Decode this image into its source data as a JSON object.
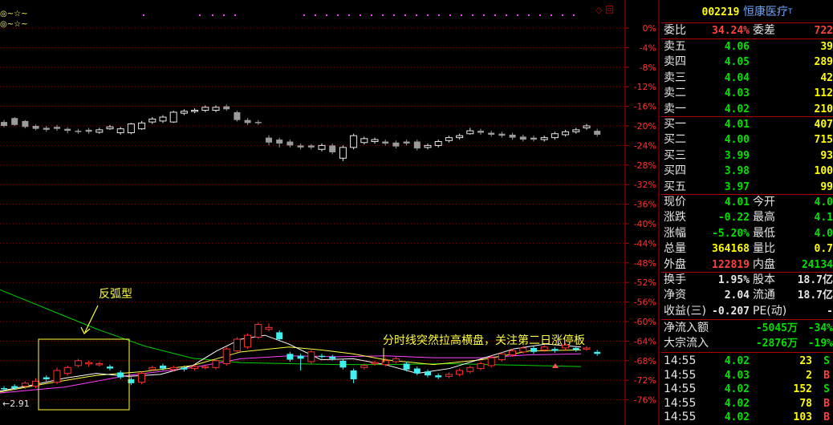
{
  "legend": {
    "line1": "◎~☆~",
    "line2": "◎~☆~"
  },
  "window_icons": {
    "diamond": "◇",
    "box": "回"
  },
  "axis": {
    "pct_labels": [
      "0%",
      "-4%",
      "-8%",
      "-12%",
      "-16%",
      "-20%",
      "-24%",
      "-28%",
      "-32%",
      "-36%",
      "-40%",
      "-44%",
      "-48%",
      "-52%",
      "-56%",
      "-60%",
      "-64%",
      "-68%",
      "-72%",
      "-76%"
    ]
  },
  "annotations": {
    "arc_label": "反弧型",
    "note": "分时线突然拉高横盘，关注第二日涨停板",
    "low_marker": "←2.91"
  },
  "stock": {
    "code": "002219",
    "name": "恒康医疗",
    "mark": "T"
  },
  "commission": {
    "label": "委比",
    "ratio": "34.24%",
    "diff_label": "委差",
    "diff": "722"
  },
  "sell_orders": [
    {
      "label": "卖五",
      "price": "4.06",
      "vol": "39"
    },
    {
      "label": "卖四",
      "price": "4.05",
      "vol": "289"
    },
    {
      "label": "卖三",
      "price": "4.04",
      "vol": "42"
    },
    {
      "label": "卖二",
      "price": "4.03",
      "vol": "112"
    },
    {
      "label": "卖一",
      "price": "4.02",
      "vol": "210"
    }
  ],
  "buy_orders": [
    {
      "label": "买一",
      "price": "4.01",
      "vol": "407"
    },
    {
      "label": "买二",
      "price": "4.00",
      "vol": "715"
    },
    {
      "label": "买三",
      "price": "3.99",
      "vol": "93"
    },
    {
      "label": "买四",
      "price": "3.98",
      "vol": "100"
    },
    {
      "label": "买五",
      "price": "3.97",
      "vol": "99"
    }
  ],
  "quote": [
    {
      "l1": "现价",
      "v1": "4.01",
      "c1": "green",
      "l2": "今开",
      "v2": "4.0",
      "c2": "green"
    },
    {
      "l1": "涨跌",
      "v1": "-0.22",
      "c1": "green",
      "l2": "最高",
      "v2": "4.1",
      "c2": "green"
    },
    {
      "l1": "涨幅",
      "v1": "-5.20%",
      "c1": "green",
      "l2": "最低",
      "v2": "4.0",
      "c2": "green"
    },
    {
      "l1": "总量",
      "v1": "364168",
      "c1": "yellow",
      "l2": "量比",
      "v2": "0.7",
      "c2": "yellow"
    },
    {
      "l1": "外盘",
      "v1": "122819",
      "c1": "red",
      "l2": "内盘",
      "v2": "24134",
      "c2": "green"
    }
  ],
  "finance": [
    {
      "l1": "换手",
      "v1": "1.95%",
      "l2": "股本",
      "v2": "18.7亿"
    },
    {
      "l1": "净资",
      "v1": "2.04",
      "l2": "流通",
      "v2": "18.7亿"
    },
    {
      "l1": "收益(三)",
      "v1": "-0.207",
      "l2": "PE(动)",
      "v2": "-"
    }
  ],
  "flows": [
    {
      "label": "净流入额",
      "v1": "-5045万",
      "v2": "-34%"
    },
    {
      "label": "大宗流入",
      "v1": "-2876万",
      "v2": "-19%"
    }
  ],
  "ticks": [
    {
      "time": "14:55",
      "price": "4.02",
      "vol": "23",
      "side": "S"
    },
    {
      "time": "14:55",
      "price": "4.03",
      "vol": "2",
      "side": "B"
    },
    {
      "time": "14:55",
      "price": "4.02",
      "vol": "152",
      "side": "S"
    },
    {
      "time": "14:55",
      "price": "4.02",
      "vol": "78",
      "side": "B"
    },
    {
      "time": "14:55",
      "price": "4.02",
      "vol": "103",
      "side": "B"
    }
  ],
  "chart_data": {
    "type": "candlestick",
    "y_axis_unit": "%",
    "ylim": [
      -78,
      2
    ],
    "upper_series_pct": [
      {
        "o": -19.2,
        "c": -20.0,
        "h": -18.8,
        "l": -20.3
      },
      {
        "o": -18.4,
        "c": -19.8,
        "h": -18.2,
        "l": -20.0
      },
      {
        "o": -19.0,
        "c": -20.2,
        "h": -18.8,
        "l": -20.5
      },
      {
        "o": -20.0,
        "c": -20.6,
        "h": -19.7,
        "l": -20.9
      },
      {
        "o": -20.4,
        "c": -20.8,
        "h": -20.0,
        "l": -21.2
      },
      {
        "o": -20.2,
        "c": -20.6,
        "h": -19.8,
        "l": -21.0
      },
      {
        "o": -20.6,
        "c": -21.0,
        "h": -20.3,
        "l": -21.5
      },
      {
        "o": -21.0,
        "c": -21.2,
        "h": -20.6,
        "l": -21.6
      },
      {
        "o": -20.8,
        "c": -21.2,
        "h": -20.4,
        "l": -21.6
      },
      {
        "o": -21.3,
        "c": -20.8,
        "h": -20.4,
        "l": -21.6
      },
      {
        "o": -20.6,
        "c": -20.2,
        "h": -19.8,
        "l": -20.8
      },
      {
        "o": -21.4,
        "c": -20.6,
        "h": -20.2,
        "l": -21.8
      },
      {
        "o": -21.4,
        "c": -19.6,
        "h": -19.4,
        "l": -21.7
      },
      {
        "o": -20.6,
        "c": -19.4,
        "h": -19.0,
        "l": -20.8
      },
      {
        "o": -19.2,
        "c": -18.6,
        "h": -18.2,
        "l": -19.6
      },
      {
        "o": -19.0,
        "c": -18.2,
        "h": -17.8,
        "l": -19.4
      },
      {
        "o": -19.2,
        "c": -17.2,
        "h": -16.9,
        "l": -19.4
      },
      {
        "o": -17.4,
        "c": -17.0,
        "h": -16.6,
        "l": -17.8
      },
      {
        "o": -17.0,
        "c": -16.8,
        "h": -16.4,
        "l": -17.4
      },
      {
        "o": -16.8,
        "c": -16.2,
        "h": -15.8,
        "l": -17.2
      },
      {
        "o": -16.8,
        "c": -16.2,
        "h": -15.8,
        "l": -17.2
      },
      {
        "o": -16.0,
        "c": -16.6,
        "h": -15.6,
        "l": -16.9
      },
      {
        "o": -17.2,
        "c": -18.8,
        "h": -16.9,
        "l": -19.1
      },
      {
        "o": -18.8,
        "c": -19.4,
        "h": -18.4,
        "l": -19.8
      },
      {
        "o": -19.2,
        "c": -19.4,
        "h": -18.8,
        "l": -19.8
      },
      {
        "o": -22.4,
        "c": -23.4,
        "h": -21.9,
        "l": -24.0
      },
      {
        "o": -22.8,
        "c": -23.6,
        "h": -22.4,
        "l": -24.4
      },
      {
        "o": -23.2,
        "c": -24.0,
        "h": -22.8,
        "l": -24.4
      },
      {
        "o": -24.0,
        "c": -24.4,
        "h": -23.6,
        "l": -24.8
      },
      {
        "o": -24.0,
        "c": -24.4,
        "h": -23.7,
        "l": -24.8
      },
      {
        "o": -24.8,
        "c": -24.0,
        "h": -23.6,
        "l": -25.2
      },
      {
        "o": -24.0,
        "c": -25.4,
        "h": -23.6,
        "l": -25.8
      },
      {
        "o": -26.6,
        "c": -24.4,
        "h": -24.0,
        "l": -27.2
      },
      {
        "o": -24.4,
        "c": -22.0,
        "h": -21.6,
        "l": -24.8
      },
      {
        "o": -23.4,
        "c": -22.6,
        "h": -22.2,
        "l": -23.8
      },
      {
        "o": -23.2,
        "c": -22.8,
        "h": -22.4,
        "l": -23.6
      },
      {
        "o": -23.2,
        "c": -23.6,
        "h": -22.8,
        "l": -24.0
      },
      {
        "o": -23.4,
        "c": -24.2,
        "h": -23.0,
        "l": -24.6
      },
      {
        "o": -23.2,
        "c": -23.6,
        "h": -22.8,
        "l": -24.0
      },
      {
        "o": -23.2,
        "c": -24.6,
        "h": -22.8,
        "l": -25.0
      },
      {
        "o": -24.4,
        "c": -24.0,
        "h": -23.6,
        "l": -24.8
      },
      {
        "o": -24.0,
        "c": -23.2,
        "h": -22.8,
        "l": -24.4
      },
      {
        "o": -23.0,
        "c": -22.4,
        "h": -22.0,
        "l": -23.4
      },
      {
        "o": -22.4,
        "c": -22.0,
        "h": -21.6,
        "l": -22.8
      },
      {
        "o": -21.6,
        "c": -21.0,
        "h": -20.4,
        "l": -21.8
      },
      {
        "o": -21.0,
        "c": -21.4,
        "h": -20.6,
        "l": -21.8
      },
      {
        "o": -21.4,
        "c": -21.8,
        "h": -21.0,
        "l": -22.2
      },
      {
        "o": -21.6,
        "c": -22.0,
        "h": -21.2,
        "l": -22.4
      },
      {
        "o": -21.8,
        "c": -22.4,
        "h": -21.4,
        "l": -22.8
      },
      {
        "o": -22.2,
        "c": -22.8,
        "h": -21.8,
        "l": -23.2
      },
      {
        "o": -22.4,
        "c": -22.8,
        "h": -22.0,
        "l": -23.2
      },
      {
        "o": -22.8,
        "c": -22.4,
        "h": -22.0,
        "l": -23.2
      },
      {
        "o": -22.4,
        "c": -21.6,
        "h": -21.2,
        "l": -22.8
      },
      {
        "o": -21.8,
        "c": -21.2,
        "h": -20.8,
        "l": -22.2
      },
      {
        "o": -21.2,
        "c": -20.8,
        "h": -20.4,
        "l": -21.6
      },
      {
        "o": -20.4,
        "c": -20.0,
        "h": -19.6,
        "l": -20.8
      },
      {
        "o": -21.0,
        "c": -21.8,
        "h": -20.6,
        "l": -22.2
      }
    ],
    "lower_series_pct": [
      {
        "o": -73.6,
        "c": -73.8,
        "h": -73.2,
        "l": -74.2
      },
      {
        "o": -73.2,
        "c": -73.6,
        "h": -72.8,
        "l": -74.0
      },
      {
        "o": -73.2,
        "c": -72.6,
        "h": -72.2,
        "l": -73.8
      },
      {
        "o": -73.2,
        "c": -72.2,
        "h": -71.6,
        "l": -73.6
      },
      {
        "o": -71.4,
        "c": -71.8,
        "h": -71.0,
        "l": -72.2
      },
      {
        "o": -72.4,
        "c": -70.0,
        "h": -69.4,
        "l": -72.8
      },
      {
        "o": -70.6,
        "c": -69.4,
        "h": -69.0,
        "l": -71.0
      },
      {
        "o": -69.0,
        "c": -68.0,
        "h": -67.6,
        "l": -69.4
      },
      {
        "o": -68.6,
        "c": -68.4,
        "h": -68.0,
        "l": -69.2
      },
      {
        "o": -68.8,
        "c": -68.6,
        "h": -68.2,
        "l": -69.2
      },
      {
        "o": -69.2,
        "c": -69.6,
        "h": -68.8,
        "l": -70.0
      },
      {
        "o": -70.4,
        "c": -71.4,
        "h": -70.0,
        "l": -71.8
      },
      {
        "o": -71.8,
        "c": -72.6,
        "h": -71.4,
        "l": -73.0
      },
      {
        "o": -72.4,
        "c": -70.6,
        "h": -70.2,
        "l": -72.8
      },
      {
        "o": -69.8,
        "c": -69.4,
        "h": -69.0,
        "l": -70.2
      },
      {
        "o": -69.0,
        "c": -69.6,
        "h": -68.6,
        "l": -70.0
      },
      {
        "o": -69.8,
        "c": -69.4,
        "h": -69.0,
        "l": -70.2
      },
      {
        "o": -69.4,
        "c": -69.8,
        "h": -69.0,
        "l": -70.2
      },
      {
        "o": -69.6,
        "c": -69.2,
        "h": -68.8,
        "l": -70.0
      },
      {
        "o": -69.4,
        "c": -69.2,
        "h": -68.8,
        "l": -69.8
      },
      {
        "o": -69.4,
        "c": -68.0,
        "h": -67.6,
        "l": -69.8
      },
      {
        "o": -68.6,
        "c": -65.6,
        "h": -65.2,
        "l": -69.0
      },
      {
        "o": -66.0,
        "c": -63.6,
        "h": -63.2,
        "l": -66.4
      },
      {
        "o": -65.2,
        "c": -62.8,
        "h": -62.4,
        "l": -65.6
      },
      {
        "o": -63.2,
        "c": -60.6,
        "h": -60.2,
        "l": -63.6
      },
      {
        "o": -61.6,
        "c": -61.2,
        "h": -60.4,
        "l": -62.0
      },
      {
        "o": -62.2,
        "c": -63.6,
        "h": -61.8,
        "l": -64.0
      },
      {
        "o": -66.6,
        "c": -67.8,
        "h": -66.2,
        "l": -68.2
      },
      {
        "o": -67.0,
        "c": -67.6,
        "h": -66.6,
        "l": -70.0
      },
      {
        "o": -68.2,
        "c": -66.2,
        "h": -65.8,
        "l": -68.6
      },
      {
        "o": -67.0,
        "c": -67.2,
        "h": -66.6,
        "l": -67.6
      },
      {
        "o": -67.2,
        "c": -67.6,
        "h": -66.8,
        "l": -68.0
      },
      {
        "o": -68.0,
        "c": -69.4,
        "h": -67.6,
        "l": -69.8
      },
      {
        "o": -70.0,
        "c": -71.8,
        "h": -69.6,
        "l": -72.6
      },
      {
        "o": -69.4,
        "c": -69.0,
        "h": -68.6,
        "l": -69.8
      },
      {
        "o": -68.6,
        "c": -68.4,
        "h": -68.0,
        "l": -69.0
      },
      {
        "o": -68.8,
        "c": -68.0,
        "h": -67.4,
        "l": -69.2
      },
      {
        "o": -68.2,
        "c": -67.6,
        "h": -67.2,
        "l": -68.6
      },
      {
        "o": -68.6,
        "c": -69.8,
        "h": -68.2,
        "l": -70.2
      },
      {
        "o": -69.6,
        "c": -70.6,
        "h": -69.2,
        "l": -71.0
      },
      {
        "o": -70.2,
        "c": -71.0,
        "h": -69.8,
        "l": -71.4
      },
      {
        "o": -71.0,
        "c": -71.4,
        "h": -70.6,
        "l": -71.8
      },
      {
        "o": -71.2,
        "c": -70.8,
        "h": -70.4,
        "l": -71.6
      },
      {
        "o": -70.8,
        "c": -70.0,
        "h": -69.6,
        "l": -71.2
      },
      {
        "o": -70.2,
        "c": -69.4,
        "h": -69.0,
        "l": -70.6
      },
      {
        "o": -69.6,
        "c": -68.6,
        "h": -68.2,
        "l": -70.0
      },
      {
        "o": -69.0,
        "c": -67.4,
        "h": -67.0,
        "l": -69.4
      },
      {
        "o": -67.8,
        "c": -66.6,
        "h": -66.2,
        "l": -68.2
      },
      {
        "o": -66.8,
        "c": -66.0,
        "h": -65.6,
        "l": -67.2
      },
      {
        "o": -66.2,
        "c": -65.4,
        "h": -65.0,
        "l": -66.6
      },
      {
        "o": -65.4,
        "c": -66.2,
        "h": -65.0,
        "l": -66.6
      },
      {
        "o": -65.8,
        "c": -65.2,
        "h": -64.8,
        "l": -66.2
      },
      {
        "o": -65.6,
        "c": -66.0,
        "h": -65.2,
        "l": -66.4
      },
      {
        "o": -65.4,
        "c": -64.8,
        "h": -64.4,
        "l": -65.8
      },
      {
        "o": -65.4,
        "c": -65.8,
        "h": -65.0,
        "l": -66.2
      },
      {
        "o": -65.6,
        "c": -65.4,
        "h": -65.0,
        "l": -66.0
      },
      {
        "o": -66.2,
        "c": -66.6,
        "h": -65.8,
        "l": -67.0
      }
    ],
    "ma_lines_pct": {
      "green": [
        [
          0,
          -53.5
        ],
        [
          60,
          -57.5
        ],
        [
          120,
          -61.5
        ],
        [
          180,
          -65.0
        ],
        [
          240,
          -67.5
        ],
        [
          300,
          -68.4
        ],
        [
          360,
          -68.6
        ],
        [
          420,
          -68.8
        ],
        [
          480,
          -68.8
        ],
        [
          560,
          -68.6
        ],
        [
          640,
          -68.9
        ],
        [
          724,
          -69.2
        ]
      ],
      "magenta": [
        [
          0,
          -74.6
        ],
        [
          80,
          -73.4
        ],
        [
          160,
          -71.0
        ],
        [
          240,
          -69.4
        ],
        [
          300,
          -67.6
        ],
        [
          360,
          -67.0
        ],
        [
          420,
          -67.2
        ],
        [
          480,
          -67.0
        ],
        [
          540,
          -67.4
        ],
        [
          600,
          -67.4
        ],
        [
          660,
          -66.8
        ],
        [
          724,
          -66.6
        ]
      ],
      "yellow": [
        [
          0,
          -74.4
        ],
        [
          60,
          -72.6
        ],
        [
          120,
          -71.0
        ],
        [
          180,
          -70.2
        ],
        [
          240,
          -69.0
        ],
        [
          300,
          -66.2
        ],
        [
          360,
          -65.2
        ],
        [
          400,
          -65.8
        ],
        [
          440,
          -66.6
        ],
        [
          480,
          -67.8
        ],
        [
          540,
          -68.8
        ],
        [
          600,
          -67.8
        ],
        [
          660,
          -66.0
        ],
        [
          724,
          -65.8
        ]
      ],
      "white": [
        [
          0,
          -74.2
        ],
        [
          40,
          -73.0
        ],
        [
          80,
          -71.6
        ],
        [
          120,
          -70.6
        ],
        [
          160,
          -71.2
        ],
        [
          200,
          -70.8
        ],
        [
          240,
          -69.0
        ],
        [
          270,
          -66.0
        ],
        [
          300,
          -63.6
        ],
        [
          330,
          -62.8
        ],
        [
          360,
          -64.6
        ],
        [
          400,
          -67.8
        ],
        [
          440,
          -67.6
        ],
        [
          480,
          -68.8
        ],
        [
          520,
          -70.6
        ],
        [
          560,
          -69.6
        ],
        [
          600,
          -67.6
        ],
        [
          640,
          -65.6
        ],
        [
          680,
          -64.6
        ],
        [
          724,
          -65.2
        ]
      ]
    },
    "top_dots_x": [
      178,
      248,
      264,
      278,
      292,
      378,
      392,
      406,
      420,
      434,
      448,
      462,
      476,
      490,
      504,
      518,
      532,
      546,
      560,
      574,
      588,
      602,
      616,
      630,
      644,
      658,
      672,
      686,
      700,
      714
    ],
    "low_marker_value": "2.91"
  }
}
